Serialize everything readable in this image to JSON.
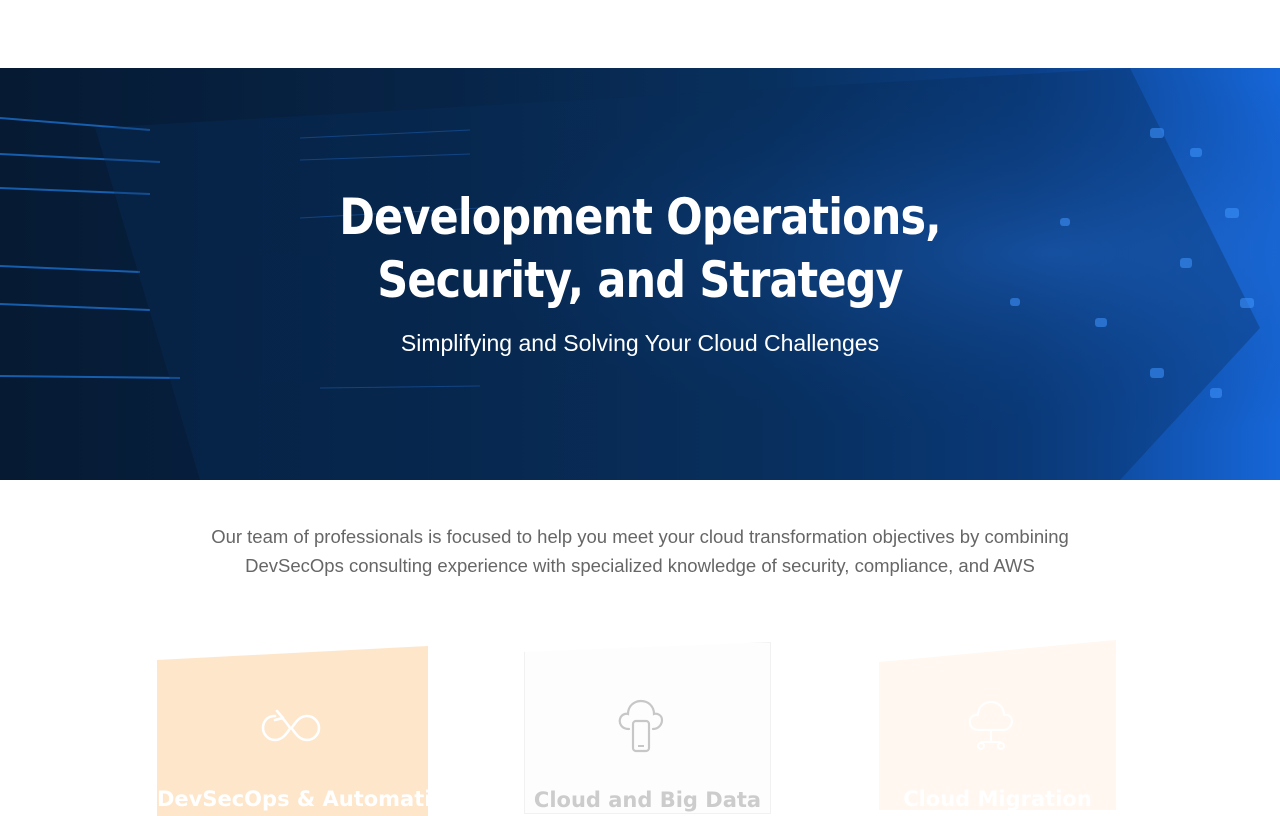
{
  "hero": {
    "title": "Development Operations, Security, and Strategy",
    "subtitle": "Simplifying and Solving Your Cloud Challenges"
  },
  "intro": {
    "text": "Our team of professionals is focused to help you meet your cloud transformation objectives by combining DevSecOps consulting experience with specialized knowledge of security, compliance, and AWS"
  },
  "cards": [
    {
      "title": "DevSecOps & Automation",
      "icon": "infinity-loop-icon",
      "color": "#fee6cb"
    },
    {
      "title": "Cloud and Big Data",
      "icon": "cloud-mobile-icon",
      "color": "#fdfdfd"
    },
    {
      "title": "Cloud Migration",
      "icon": "cloud-network-icon",
      "color": "#fff7f0"
    }
  ],
  "colors": {
    "hero_dark": "#061a33",
    "hero_light": "#1666d8",
    "intro_text": "#666666"
  }
}
